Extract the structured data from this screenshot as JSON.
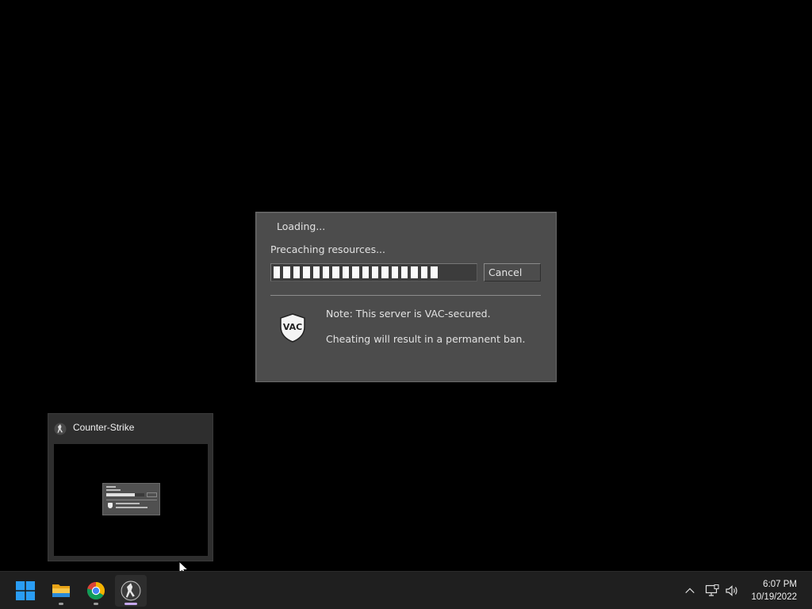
{
  "dialog": {
    "title": "Loading...",
    "status": "Precaching resources...",
    "progress": 0.69,
    "progress_segments_filled": 17,
    "cancel_label": "Cancel",
    "vac_icon": "vac-shield-icon",
    "vac_text": "VAC",
    "note_line1": "Note: This server is VAC-secured.",
    "note_line2": "Cheating will result in a permanent ban."
  },
  "preview": {
    "title": "Counter-Strike",
    "icon": "counter-strike-icon"
  },
  "taskbar": {
    "apps": [
      {
        "name": "start",
        "icon": "windows-start-icon"
      },
      {
        "name": "file-explorer",
        "icon": "folder-icon",
        "running": true
      },
      {
        "name": "chrome",
        "icon": "chrome-icon",
        "running": true
      },
      {
        "name": "counter-strike",
        "icon": "counter-strike-icon",
        "running": true,
        "active": true
      }
    ],
    "tray_icons": [
      "chevron-up-icon",
      "network-icon",
      "volume-icon"
    ],
    "time": "6:07 PM",
    "date": "10/19/2022"
  },
  "colors": {
    "dialog_bg": "#4c4c4c",
    "accent_indicator": "#c7a8f0",
    "taskbar_bg": "#1f1f1f"
  }
}
